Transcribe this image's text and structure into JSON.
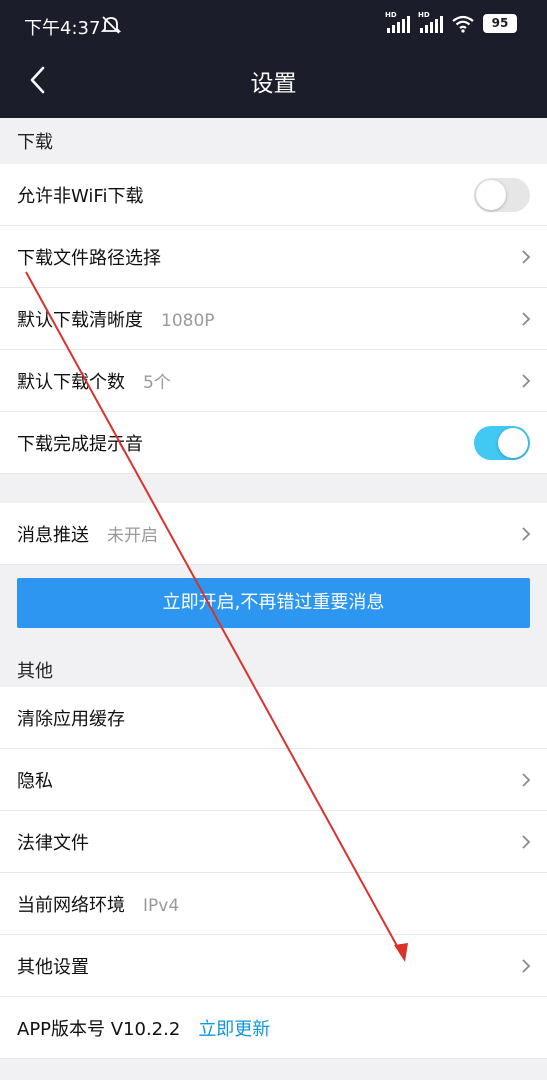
{
  "status_bar": {
    "time": "下午4:37",
    "signal_1_tag": "HD",
    "signal_2_tag": "HD",
    "battery": "95",
    "icons": [
      "mute-icon",
      "signal-icon",
      "signal-icon",
      "wifi-icon",
      "battery-icon"
    ]
  },
  "header": {
    "title": "设置",
    "back_icon": "chevron-left-icon"
  },
  "sections": {
    "download": {
      "title": "下载",
      "allow_non_wifi": {
        "label": "允许非WiFi下载",
        "enabled": false
      },
      "path_select": {
        "label": "下载文件路径选择"
      },
      "default_quality": {
        "label": "默认下载清晰度",
        "value": "1080P"
      },
      "default_count": {
        "label": "默认下载个数",
        "value": "5个"
      },
      "finish_sound": {
        "label": "下载完成提示音",
        "enabled": true
      }
    },
    "push": {
      "label": "消息推送",
      "value": "未开启",
      "cta": "立即开启,不再错过重要消息"
    },
    "other": {
      "title": "其他",
      "clear_cache": {
        "label": "清除应用缓存"
      },
      "privacy": {
        "label": "隐私"
      },
      "legal": {
        "label": "法律文件"
      },
      "network": {
        "label": "当前网络环境",
        "value": "IPv4"
      },
      "other_settings": {
        "label": "其他设置"
      },
      "version": {
        "label": "APP版本号 V10.2.2",
        "link": "立即更新"
      }
    }
  },
  "colors": {
    "header_bg": "#1c1d2a",
    "toggle_on": "#41c8f3",
    "cta_bg": "#2c96f0",
    "link": "#1296db",
    "annotation_arrow": "#d9322c"
  }
}
